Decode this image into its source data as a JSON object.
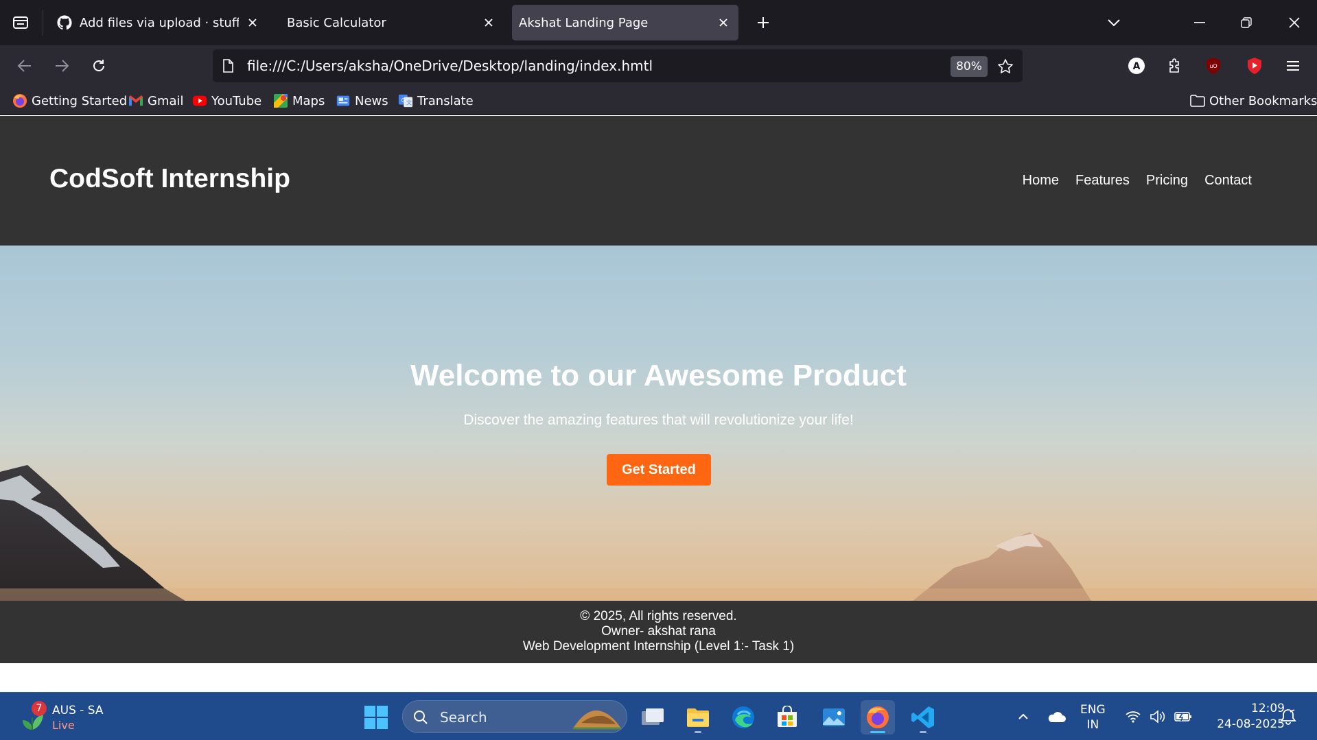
{
  "browser": {
    "tabs": [
      {
        "title": "Add files via upload · stuffrandom",
        "icon": "github-icon",
        "active": false
      },
      {
        "title": "Basic Calculator",
        "icon": "",
        "active": false
      },
      {
        "title": "Akshat Landing Page",
        "icon": "",
        "active": true
      }
    ],
    "url": "file:///C:/Users/aksha/OneDrive/Desktop/landing/index.hmtl",
    "zoom": "80%",
    "bookmarks": [
      {
        "label": "Getting Started",
        "icon": "firefox-icon"
      },
      {
        "label": "Gmail",
        "icon": "gmail-icon"
      },
      {
        "label": "YouTube",
        "icon": "youtube-icon"
      },
      {
        "label": "Maps",
        "icon": "maps-icon"
      },
      {
        "label": "News",
        "icon": "news-icon"
      },
      {
        "label": "Translate",
        "icon": "translate-icon"
      }
    ],
    "other_bookmarks": "Other Bookmarks",
    "profile_initial": "A"
  },
  "page": {
    "brand": "CodSoft Internship",
    "nav": [
      "Home",
      "Features",
      "Pricing",
      "Contact"
    ],
    "hero": {
      "title": "Welcome to our Awesome Product",
      "subtitle": "Discover the amazing features that will revolutionize your life!",
      "cta": "Get Started"
    },
    "footer": {
      "line1": "© 2025, All rights reserved.",
      "line2": "Owner- akshat rana",
      "line3": "Web Development Internship (Level 1:- Task 1)"
    },
    "colors": {
      "header_bg": "#333333",
      "cta_bg": "#ff6611"
    }
  },
  "taskbar": {
    "weather": {
      "badge": "7",
      "location": "AUS - SA",
      "status": "Live"
    },
    "search_placeholder": "Search",
    "apps": [
      "task-view",
      "file-explorer",
      "edge",
      "microsoft-store",
      "photos",
      "firefox",
      "vscode"
    ],
    "lang": {
      "top": "ENG",
      "bottom": "IN"
    },
    "time": "12:09",
    "date": "24-08-2025"
  }
}
